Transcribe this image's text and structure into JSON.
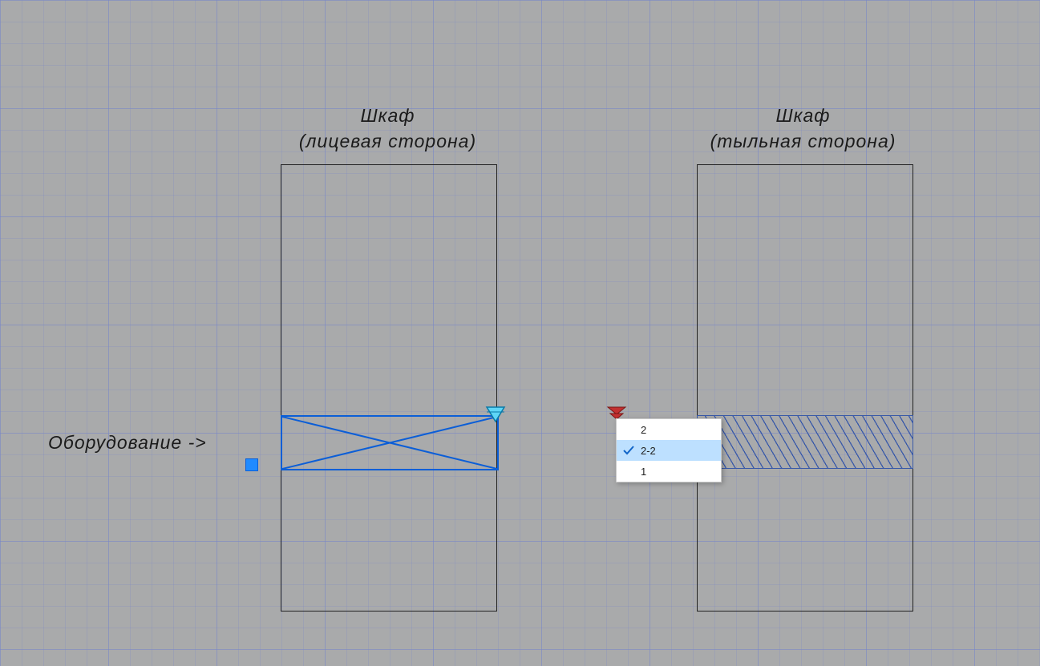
{
  "labels": {
    "cabinet_front_line1": "Шкаф",
    "cabinet_front_line2": "(лицевая сторона)",
    "cabinet_back_line1": "Шкаф",
    "cabinet_back_line2": "(тыльная сторона)",
    "equipment_arrow": "Оборудование ->"
  },
  "menu": {
    "items": [
      {
        "label": "2",
        "selected": false
      },
      {
        "label": "2-2",
        "selected": true
      },
      {
        "label": "1",
        "selected": false
      }
    ]
  },
  "colors": {
    "selection": "#0b5ed7",
    "marker_blue": "#19b6ea",
    "marker_red": "#c02020",
    "hatch": "#3a5aa8",
    "canvas": "#a9aaab"
  }
}
